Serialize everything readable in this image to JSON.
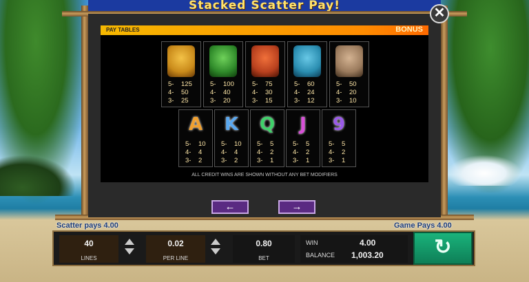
{
  "title": "Stacked Scatter Pay!",
  "paytable": {
    "header_left": "PAY TABLES",
    "header_right": "BONUS",
    "icon_symbols": [
      {
        "icon": "tiki-mask-gold-icon",
        "color": "#c98a1a",
        "pays": [
          [
            "5-",
            "125"
          ],
          [
            "4-",
            "50"
          ],
          [
            "3-",
            "25"
          ]
        ]
      },
      {
        "icon": "tiki-mask-green-icon",
        "color": "#2f8a2a",
        "pays": [
          [
            "5-",
            "100"
          ],
          [
            "4-",
            "40"
          ],
          [
            "3-",
            "20"
          ]
        ]
      },
      {
        "icon": "tiki-mask-red-icon",
        "color": "#b8401e",
        "pays": [
          [
            "5-",
            "75"
          ],
          [
            "4-",
            "30"
          ],
          [
            "3-",
            "15"
          ]
        ]
      },
      {
        "icon": "tiki-mask-teal-icon",
        "color": "#2a8db0",
        "pays": [
          [
            "5-",
            "60"
          ],
          [
            "4-",
            "24"
          ],
          [
            "3-",
            "12"
          ]
        ]
      },
      {
        "icon": "moai-head-icon",
        "color": "#9a7a5c",
        "pays": [
          [
            "5-",
            "50"
          ],
          [
            "4-",
            "20"
          ],
          [
            "3-",
            "10"
          ]
        ]
      }
    ],
    "letter_symbols": [
      {
        "letter": "A",
        "color": "#f0a030",
        "pays": [
          [
            "5-",
            "10"
          ],
          [
            "4-",
            "4"
          ],
          [
            "3-",
            "2"
          ]
        ]
      },
      {
        "letter": "K",
        "color": "#5aa8f0",
        "pays": [
          [
            "5-",
            "10"
          ],
          [
            "4-",
            "4"
          ],
          [
            "3-",
            "2"
          ]
        ]
      },
      {
        "letter": "Q",
        "color": "#3fd16a",
        "pays": [
          [
            "5-",
            "5"
          ],
          [
            "4-",
            "2"
          ],
          [
            "3-",
            "1"
          ]
        ]
      },
      {
        "letter": "J",
        "color": "#d84fd8",
        "pays": [
          [
            "5-",
            "5"
          ],
          [
            "4-",
            "2"
          ],
          [
            "3-",
            "1"
          ]
        ]
      },
      {
        "letter": "9",
        "color": "#9a5ae8",
        "pays": [
          [
            "5-",
            "5"
          ],
          [
            "4-",
            "2"
          ],
          [
            "3-",
            "1"
          ]
        ]
      }
    ],
    "footnote": "ALL CREDIT WINS ARE SHOWN WITHOUT ANY BET MODIFIERS",
    "prev_label": "←",
    "next_label": "→"
  },
  "close_label": "✕",
  "messages": {
    "left": "Scatter pays 4.00",
    "right": "Game Pays 4.00"
  },
  "console": {
    "lines_value": "40",
    "lines_label": "LINES",
    "per_line_value": "0.02",
    "per_line_label": "PER LINE",
    "bet_value": "0.80",
    "bet_label": "BET",
    "win_label": "WIN",
    "win_value": "4.00",
    "balance_label": "BALANCE",
    "balance_value": "1,003.20",
    "spin_label": "↻"
  }
}
